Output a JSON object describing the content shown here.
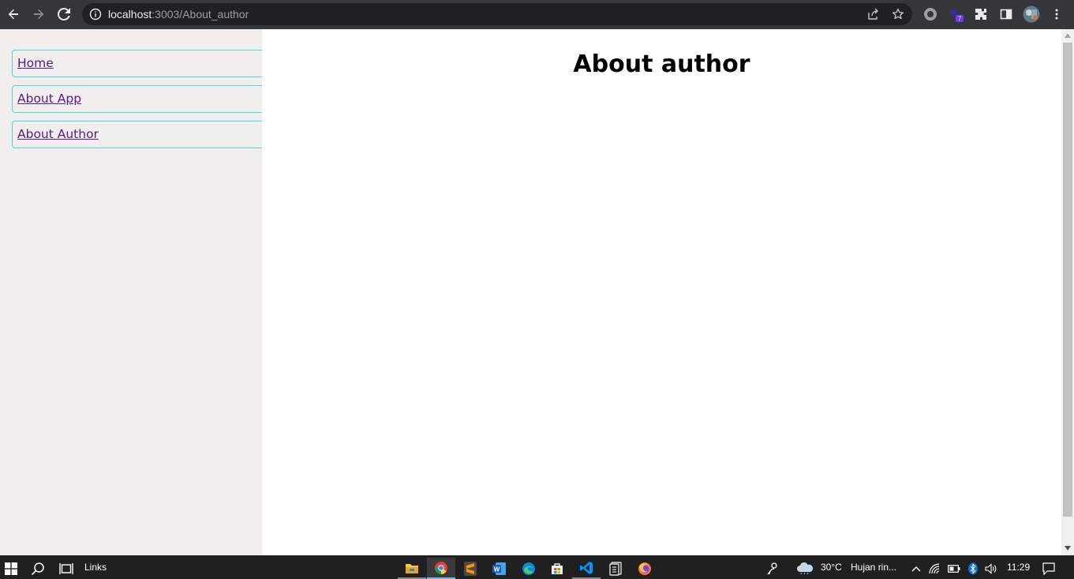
{
  "browser": {
    "url_host": "localhost",
    "url_path": ":3003/About_author",
    "extension_badge": "7"
  },
  "sidebar": {
    "items": [
      {
        "label": "Home"
      },
      {
        "label": "About App"
      },
      {
        "label": "About Author"
      }
    ]
  },
  "main": {
    "title": "About author"
  },
  "taskbar": {
    "links_label": "Links",
    "weather_temp": "30°C",
    "weather_text": "Hujan rin...",
    "clock": "11:29"
  },
  "colors": {
    "sidebar_bg": "#f3eeee",
    "link_border": "#40e0d0",
    "link_text": "#551a8b"
  }
}
